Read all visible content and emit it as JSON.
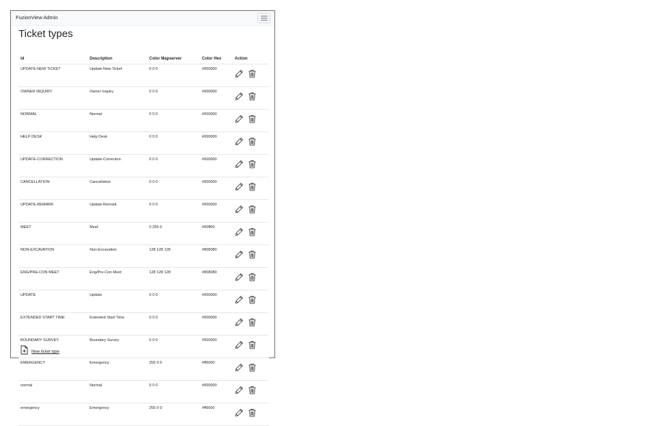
{
  "navbar": {
    "brand": "FuzionView Admin"
  },
  "page": {
    "title": "Ticket types"
  },
  "table": {
    "headers": [
      "Id",
      "Description",
      "Color Mapserver",
      "Color Hex",
      "Action"
    ],
    "rows": [
      {
        "id": "UPDATE-NEW TICKET",
        "description": "Update-New Ticket",
        "color_mapserver": "0 0 0",
        "color_hex": "#000000"
      },
      {
        "id": "OWNER INQUIRY",
        "description": "Owner Inquiry",
        "color_mapserver": "0 0 0",
        "color_hex": "#000000"
      },
      {
        "id": "NORMAL",
        "description": "Normal",
        "color_mapserver": "0 0 0",
        "color_hex": "#000000"
      },
      {
        "id": "HELP DESK",
        "description": "Help Desk",
        "color_mapserver": "0 0 0",
        "color_hex": "#000000"
      },
      {
        "id": "UPDATE-CORRECTION",
        "description": "Update-Correction",
        "color_mapserver": "0 0 0",
        "color_hex": "#000000"
      },
      {
        "id": "CANCELLATION",
        "description": "Cancellation",
        "color_mapserver": "0 0 0",
        "color_hex": "#000000"
      },
      {
        "id": "UPDATE-REMARK",
        "description": "Update-Remark",
        "color_mapserver": "0 0 0",
        "color_hex": "#000000"
      },
      {
        "id": "MEET",
        "description": "Meet",
        "color_mapserver": "0 255 0",
        "color_hex": "#00ff00"
      },
      {
        "id": "NON-EXCAVATION",
        "description": "Non-Excavation",
        "color_mapserver": "128 128 128",
        "color_hex": "#808080"
      },
      {
        "id": "ENG/PRE-CON MEET",
        "description": "Eng/Pre-Con Meet",
        "color_mapserver": "128 128 128",
        "color_hex": "#808080"
      },
      {
        "id": "UPDATE",
        "description": "Update",
        "color_mapserver": "0 0 0",
        "color_hex": "#000000"
      },
      {
        "id": "EXTENDED START TIME",
        "description": "Extended Start Time",
        "color_mapserver": "0 0 0",
        "color_hex": "#000000"
      },
      {
        "id": "BOUNDARY SURVEY",
        "description": "Boundary Survey",
        "color_mapserver": "0 0 0",
        "color_hex": "#000000"
      },
      {
        "id": "EMERGENCY",
        "description": "Emergency",
        "color_mapserver": "255 0 0",
        "color_hex": "#ff0000"
      },
      {
        "id": "normal",
        "description": "Normal",
        "color_mapserver": "0 0 0",
        "color_hex": "#000000"
      },
      {
        "id": "emergency",
        "description": "Emergency",
        "color_mapserver": "255 0 0",
        "color_hex": "#ff0000"
      }
    ],
    "row_actions": [
      {
        "icon": "pencil-icon",
        "action": "edit"
      },
      {
        "icon": "trash-icon",
        "action": "delete"
      }
    ]
  },
  "footer": {
    "new_link_label": "New ticket type",
    "new_link_icon": "file-plus-icon"
  }
}
